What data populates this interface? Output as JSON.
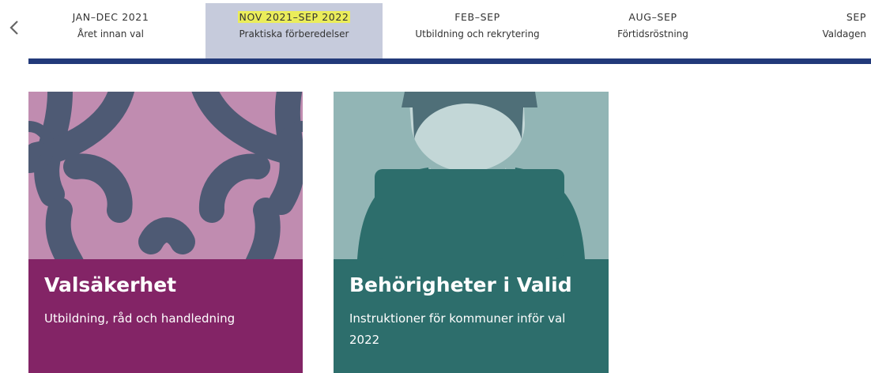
{
  "timeline": {
    "tabs": [
      {
        "period": "JAN–DEC 2021",
        "label": "Året innan val"
      },
      {
        "period": "NOV 2021–SEP 2022",
        "label": "Praktiska förberedelser"
      },
      {
        "period": "FEB–SEP",
        "label": "Utbildning och rekrytering"
      },
      {
        "period": "AUG–SEP",
        "label": "Förtidsröstning"
      },
      {
        "period": "SEP",
        "label": "Valdagen"
      }
    ],
    "active_index": 1,
    "highlight_color": "#ebed5a",
    "active_tab_color": "#c6cbdc",
    "rule_color": "#223a7a",
    "prev_icon": "chevron-left-icon"
  },
  "cards": [
    {
      "title": "Valsäkerhet",
      "subtitle": "Utbildning, råd och handledning",
      "panel_color": "#832466",
      "art_color": "#c08cb0",
      "icon": "interlocking-hands-illustration"
    },
    {
      "title": "Behörigheter i Valid",
      "subtitle": "Instruktioner för kommuner inför val 2022",
      "panel_color": "#2d6e6c",
      "art_color": "#92b5b5",
      "icon": "person-at-laptop-illustration"
    }
  ]
}
